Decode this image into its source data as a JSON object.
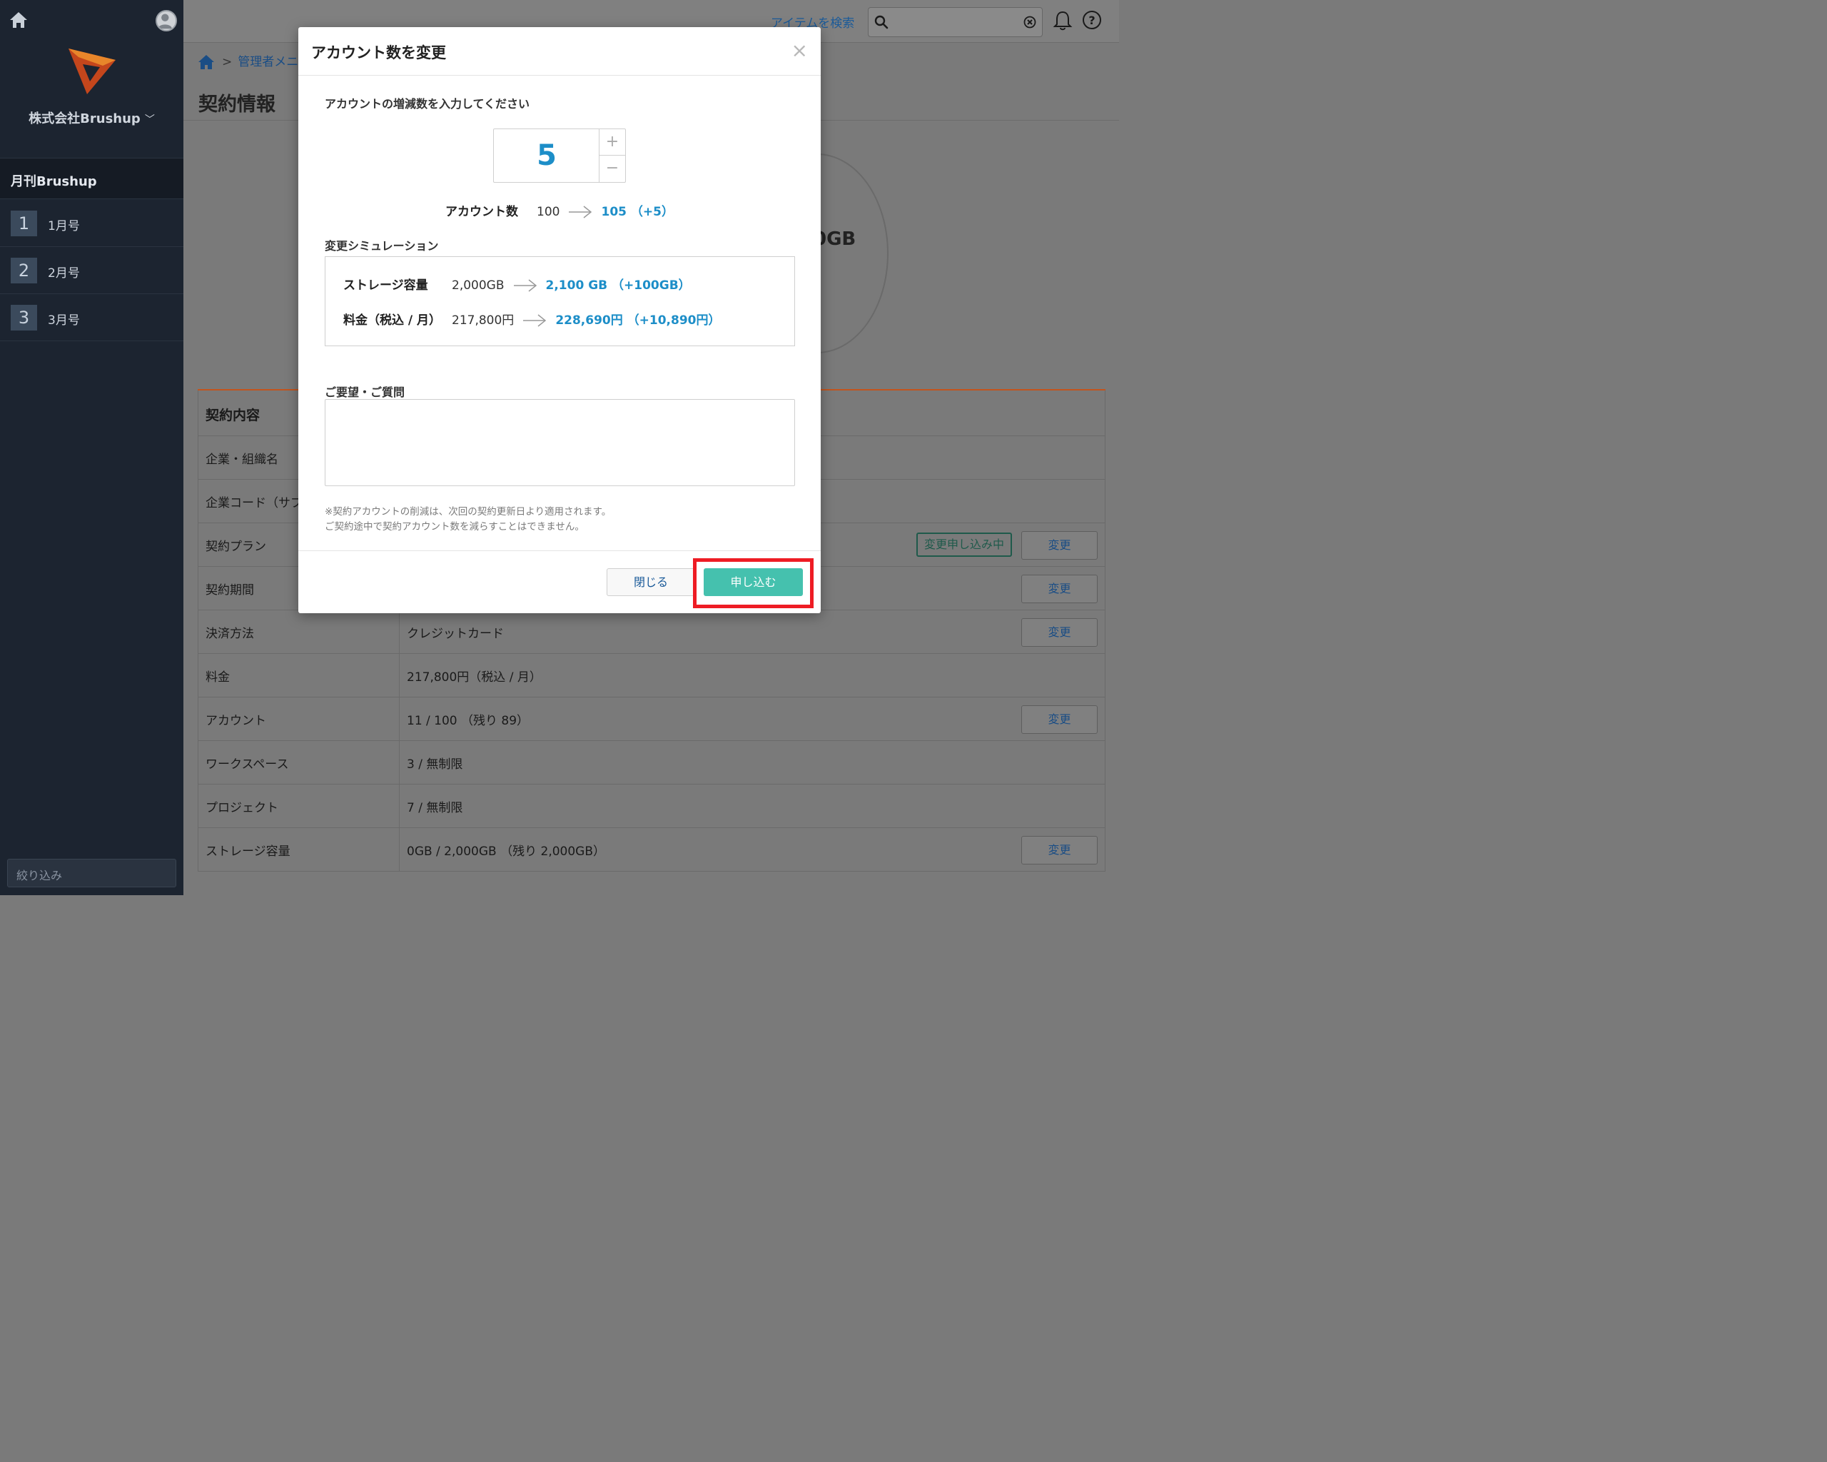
{
  "sidebar": {
    "company": "株式会社Brushup",
    "section": "月刊Brushup",
    "items": [
      {
        "num": "1",
        "label": "1月号"
      },
      {
        "num": "2",
        "label": "2月号"
      },
      {
        "num": "3",
        "label": "3月号"
      }
    ],
    "filter_placeholder": "絞り込み"
  },
  "topbar": {
    "search_link": "アイテムを検索"
  },
  "breadcrumb": {
    "item": "管理者メニ"
  },
  "page": {
    "title": "契約情報",
    "storage_circle_value": "0GB"
  },
  "table": {
    "heading": "契約内容",
    "rows": [
      {
        "label": "企業・組織名",
        "value": "",
        "button": ""
      },
      {
        "label": "企業コード（サブ",
        "value": "",
        "button": ""
      },
      {
        "label": "契約プラン",
        "value": "",
        "pending": "変更申し込み中",
        "button": "変更"
      },
      {
        "label": "契約期間",
        "value": "",
        "button": "変更"
      },
      {
        "label": "決済方法",
        "value": "クレジットカード",
        "button": "変更"
      },
      {
        "label": "料金",
        "value": "217,800円（税込 / 月）",
        "button": ""
      },
      {
        "label": "アカウント",
        "value": "11 / 100 （残り 89）",
        "button": "変更"
      },
      {
        "label": "ワークスペース",
        "value": "3 / 無制限",
        "button": ""
      },
      {
        "label": "プロジェクト",
        "value": "7 / 無制限",
        "button": ""
      },
      {
        "label": "ストレージ容量",
        "value": "0GB / 2,000GB （残り 2,000GB）",
        "button": "変更"
      }
    ]
  },
  "modal": {
    "title": "アカウント数を変更",
    "close_icon": "×",
    "prompt": "アカウントの増減数を入力してください",
    "stepper_value": "5",
    "stepper_plus": "+",
    "stepper_minus": "−",
    "account_label": "アカウント数",
    "account_old": "100",
    "account_new": "105 （+5）",
    "simulation_title": "変更シミュレーション",
    "storage_label": "ストレージ容量",
    "storage_old": "2,000GB",
    "storage_new": "2,100 GB （+100GB）",
    "price_label": "料金（税込 / 月）",
    "price_old": "217,800円",
    "price_new": "228,690円 （+10,890円）",
    "request_title": "ご要望・ご質問",
    "request_value": "",
    "note_line1": "※契約アカウントの削減は、次回の契約更新日より適用されます。",
    "note_line2": "ご契約途中で契約アカウント数を減らすことはできません。",
    "close_button": "閉じる",
    "submit_button": "申し込む"
  },
  "colors": {
    "accent_blue": "#1d8ec8",
    "submit_teal": "#45c1ae",
    "highlight_red": "#ee1c24",
    "table_top_border": "#c2541e",
    "sidebar_bg": "#1c2430"
  }
}
